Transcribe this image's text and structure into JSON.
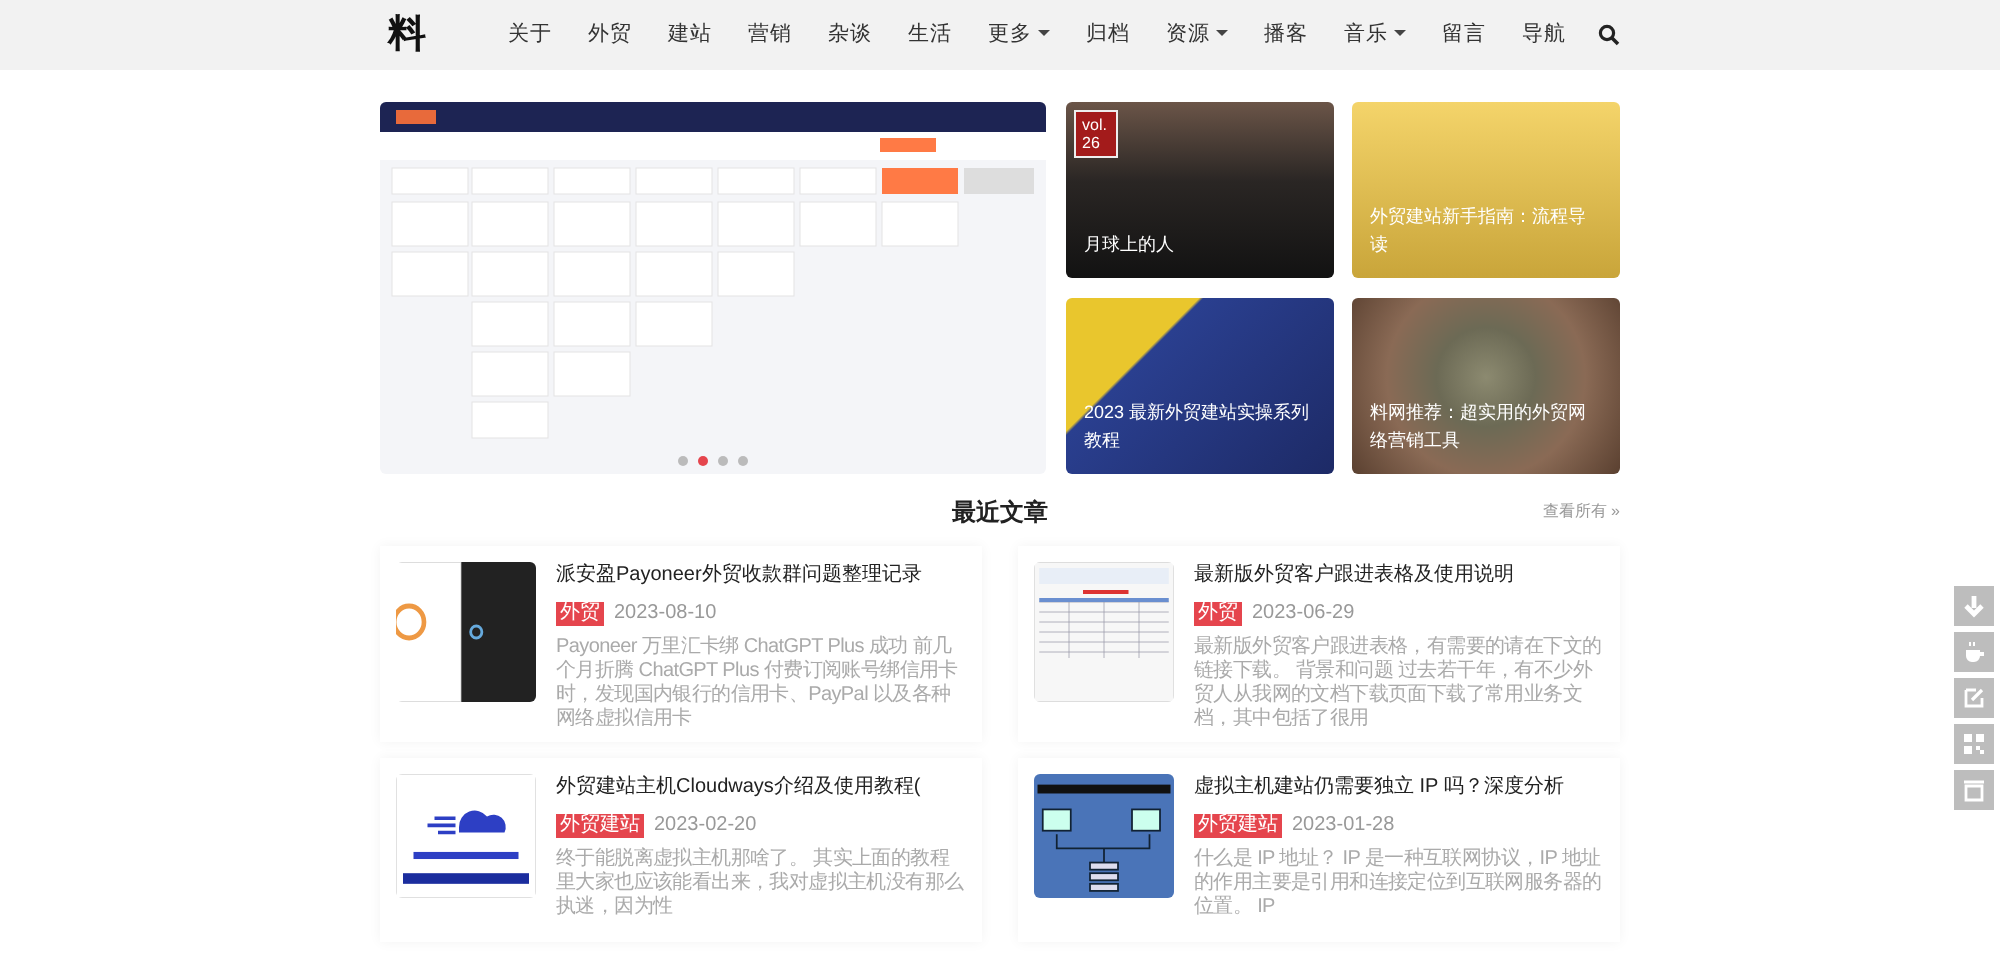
{
  "header": {
    "logo": "料",
    "nav": [
      {
        "label": "关于",
        "dropdown": false
      },
      {
        "label": "外贸",
        "dropdown": false
      },
      {
        "label": "建站",
        "dropdown": false
      },
      {
        "label": "营销",
        "dropdown": false
      },
      {
        "label": "杂谈",
        "dropdown": false
      },
      {
        "label": "生活",
        "dropdown": false
      },
      {
        "label": "更多",
        "dropdown": true
      },
      {
        "label": "归档",
        "dropdown": false
      },
      {
        "label": "资源",
        "dropdown": true
      },
      {
        "label": "播客",
        "dropdown": false
      },
      {
        "label": "音乐",
        "dropdown": true
      },
      {
        "label": "留言",
        "dropdown": false
      },
      {
        "label": "导航",
        "dropdown": false
      }
    ]
  },
  "carousel": {
    "dots": [
      {
        "selected": false
      },
      {
        "selected": true
      },
      {
        "selected": false
      },
      {
        "selected": false
      }
    ]
  },
  "featured": [
    {
      "title": "月球上的人",
      "kind": "night",
      "badge": "vol. 26"
    },
    {
      "title": "外贸建站新手指南：流程导读",
      "kind": "yellow"
    },
    {
      "title": "2023 最新外贸建站实操系列教程",
      "kind": "ladder"
    },
    {
      "title": "料网推荐：超实用的外贸网络营销工具",
      "kind": "plant"
    }
  ],
  "recent": {
    "title": "最近文章",
    "view_all": "查看所有 »",
    "posts": [
      {
        "title": "派安盈Payoneer外贸收款群问题整理记录",
        "tag": "外贸",
        "date": "2023-08-10",
        "excerpt": "Payoneer 万里汇卡绑 ChatGPT Plus 成功 前几个月折腾 ChatGPT Plus 付费订阅账号绑信用卡时，发现国内银行的信用卡、PayPal 以及各种网络虚拟信用卡",
        "kind": "ring"
      },
      {
        "title": "最新版外贸客户跟进表格及使用说明",
        "tag": "外贸",
        "date": "2023-06-29",
        "excerpt": "最新版外贸客户跟进表格，有需要的请在下文的链接下载。 背景和问题 过去若干年，有不少外贸人从我网的文档下载页面下载了常用业务文档，其中包括了很用",
        "kind": "sheet"
      },
      {
        "title": "外贸建站主机Cloudways介绍及使用教程(",
        "tag": "外贸建站",
        "date": "2023-02-20",
        "excerpt": "终于能脱离虚拟主机那啥了。 其实上面的教程里大家也应该能看出来，我对虚拟主机没有那么执迷，因为性",
        "kind": "cloud"
      },
      {
        "title": "虚拟主机建站仍需要独立 IP 吗？深度分析",
        "tag": "外贸建站",
        "date": "2023-01-28",
        "excerpt": "什么是 IP 地址？ IP 是一种互联网协议，IP 地址的作用主要是引用和连接定位到互联网服务器的位置。 IP",
        "kind": "diagram"
      }
    ]
  },
  "side_tools": [
    {
      "kind": "down"
    },
    {
      "kind": "coffee"
    },
    {
      "kind": "edit"
    },
    {
      "kind": "qr"
    },
    {
      "kind": "tray"
    }
  ]
}
